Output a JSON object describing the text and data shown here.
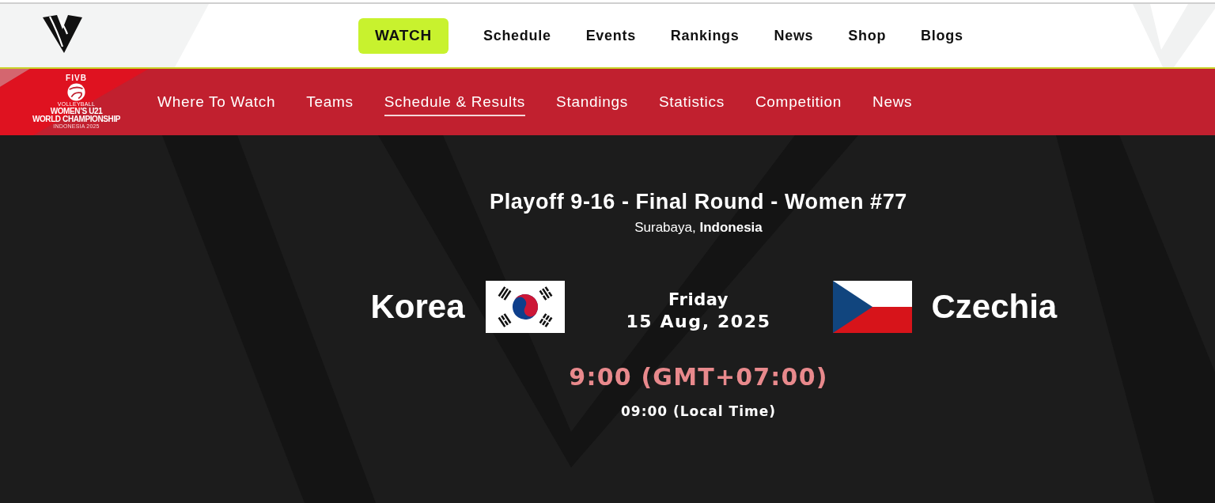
{
  "header": {
    "watch_button": "WATCH",
    "nav": [
      {
        "label": "Schedule"
      },
      {
        "label": "Events"
      },
      {
        "label": "Rankings"
      },
      {
        "label": "News"
      },
      {
        "label": "Shop"
      },
      {
        "label": "Blogs"
      }
    ]
  },
  "event_bar": {
    "logo": {
      "org": "FIVB",
      "sport": "VOLLEYBALL",
      "title_1": "WOMEN’S U21",
      "title_2": "WORLD CHAMPIONSHIP",
      "host": "INDONESIA 2025"
    },
    "tabs": [
      {
        "label": "Where To Watch",
        "selected": false
      },
      {
        "label": "Teams",
        "selected": false
      },
      {
        "label": "Schedule & Results",
        "selected": true
      },
      {
        "label": "Standings",
        "selected": false
      },
      {
        "label": "Statistics",
        "selected": false
      },
      {
        "label": "Competition",
        "selected": false
      },
      {
        "label": "News",
        "selected": false
      }
    ]
  },
  "match": {
    "title": "Playoff 9-16 - Final Round - Women #77",
    "venue": "Surabaya, **Indonesia**",
    "teams": [
      {
        "name": "Korea",
        "kind": "korea"
      },
      {
        "name": "Czechia",
        "kind": "czechia"
      }
    ],
    "day": "Friday",
    "date": "15 Aug, 2025",
    "time": "9:00 (GMT+07:00)",
    "local_time": "09:00 (Local Time)"
  }
}
